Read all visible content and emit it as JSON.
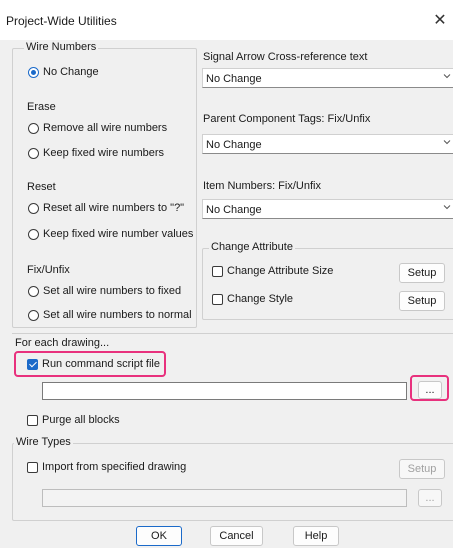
{
  "window": {
    "title": "Project-Wide Utilities",
    "close": "✕"
  },
  "wire_numbers": {
    "legend": "Wire Numbers",
    "no_change": "No Change",
    "erase_label": "Erase",
    "remove_all": "Remove all wire numbers",
    "keep_fixed": "Keep fixed wire numbers",
    "reset_label": "Reset",
    "reset_all": "Reset all wire numbers to \"?\"",
    "keep_fixed_values": "Keep fixed wire number values",
    "fix_unfix_label": "Fix/Unfix",
    "set_fixed": "Set all wire numbers to fixed",
    "set_normal": "Set all wire numbers to normal"
  },
  "signal_arrow": {
    "label": "Signal Arrow Cross-reference text",
    "value": "No Change"
  },
  "parent_tags": {
    "label": "Parent Component Tags: Fix/Unfix",
    "value": "No Change"
  },
  "item_numbers": {
    "label": "Item Numbers: Fix/Unfix",
    "value": "No Change"
  },
  "change_attribute": {
    "legend": "Change Attribute",
    "size_label": "Change Attribute Size",
    "style_label": "Change Style",
    "setup": "Setup"
  },
  "each_drawing": {
    "label": "For each drawing...",
    "run_script": "Run command script file",
    "run_script_checked": true,
    "script_path": "",
    "browse": "...",
    "purge": "Purge all blocks"
  },
  "wire_types": {
    "legend": "Wire Types",
    "import_label": "Import from specified drawing",
    "setup": "Setup",
    "path": "",
    "browse": "..."
  },
  "footer": {
    "ok": "OK",
    "cancel": "Cancel",
    "help": "Help"
  },
  "colors": {
    "accent": "#1b6ac9",
    "highlight": "#e8317d",
    "background": "#f0f0f0"
  }
}
